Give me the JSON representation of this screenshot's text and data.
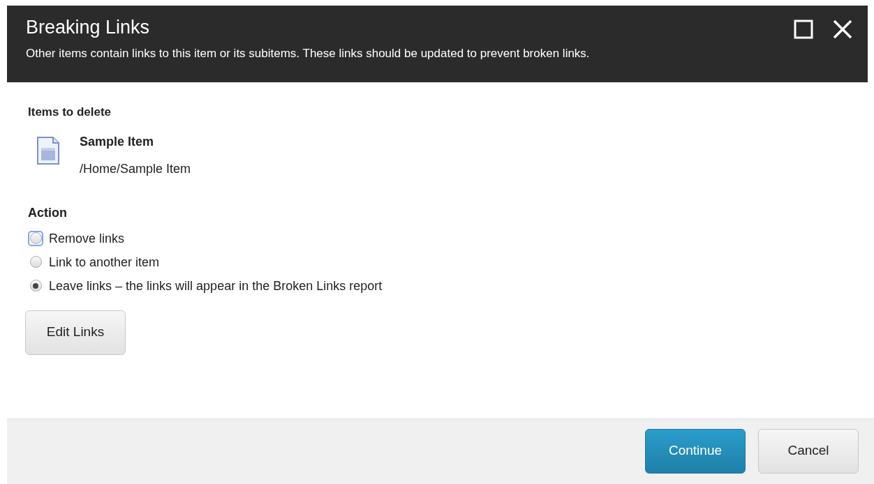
{
  "dialog": {
    "title": "Breaking Links",
    "subtitle": "Other items contain links to this item or its subitems. These links should be updated to prevent broken links."
  },
  "items_section": {
    "heading": "Items to delete",
    "items": [
      {
        "name": "Sample Item",
        "path": "/Home/Sample Item"
      }
    ]
  },
  "action_section": {
    "heading": "Action",
    "options": [
      {
        "label": "Remove links",
        "selected": false,
        "focused": true
      },
      {
        "label": "Link to another item",
        "selected": false,
        "focused": false
      },
      {
        "label": "Leave links – the links will appear in the Broken Links report",
        "selected": true,
        "focused": false
      }
    ],
    "button": "Edit Links"
  },
  "footer_buttons": [
    {
      "label": "Continue",
      "kind": "primary"
    },
    {
      "label": "Cancel",
      "kind": "secondary"
    }
  ]
}
